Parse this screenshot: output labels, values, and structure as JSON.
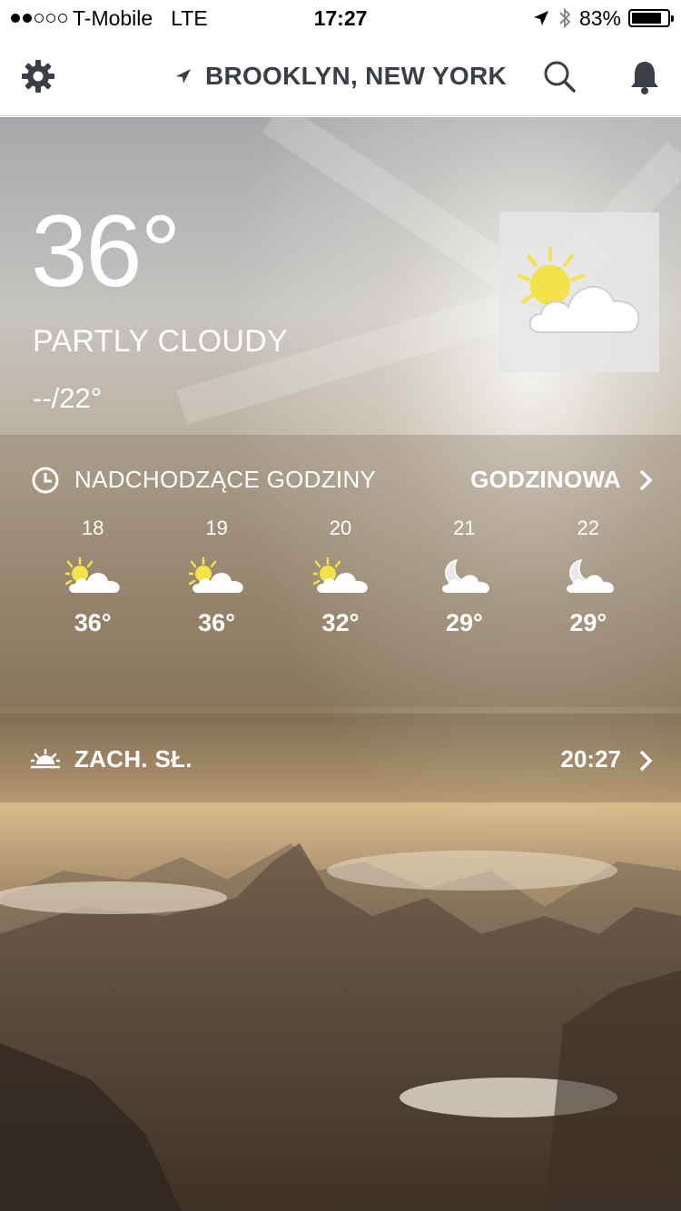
{
  "status_bar": {
    "carrier": "T-Mobile",
    "network": "LTE",
    "time": "17:27",
    "battery": "83%",
    "battery_level": 0.83
  },
  "header": {
    "location": "BROOKLYN, NEW YORK"
  },
  "current": {
    "temperature": "36°",
    "condition": "PARTLY CLOUDY",
    "hi_lo": "--/22°"
  },
  "hourly": {
    "title": "NADCHODZĄCE GODZINY",
    "link_label": "GODZINOWA",
    "items": [
      {
        "time": "18",
        "temp": "36°",
        "icon": "partly-cloudy-day-icon"
      },
      {
        "time": "19",
        "temp": "36°",
        "icon": "partly-cloudy-day-icon"
      },
      {
        "time": "20",
        "temp": "32°",
        "icon": "partly-cloudy-day-icon"
      },
      {
        "time": "21",
        "temp": "29°",
        "icon": "partly-cloudy-night-icon"
      },
      {
        "time": "22",
        "temp": "29°",
        "icon": "partly-cloudy-night-icon"
      }
    ]
  },
  "sunset": {
    "label": "ZACH. SŁ.",
    "time": "20:27"
  },
  "colors": {
    "header_text": "#3a3f46",
    "sun": "#f3e24a"
  }
}
